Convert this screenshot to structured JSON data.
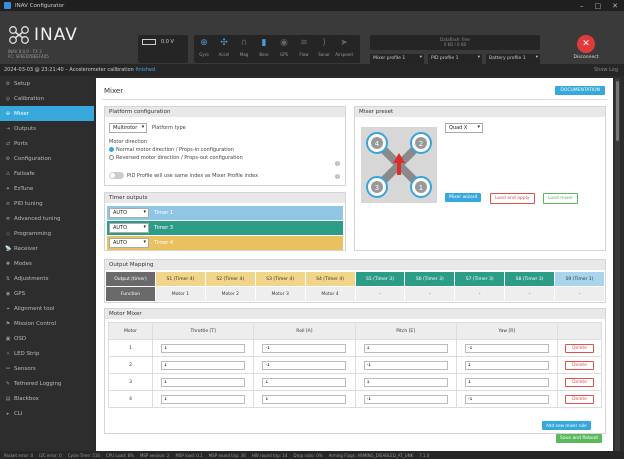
{
  "window": {
    "title": "INAV Configurator",
    "minimize": "–",
    "maximize": "□",
    "close": "✕"
  },
  "header": {
    "logo_text": "INAV",
    "version_line1": "INAV 8.0.0 · TX 3",
    "version_line2": "FC: SPEEDYBEEF405",
    "battery_voltage": "0.0 V",
    "sensors": [
      {
        "icon": "gyro-icon",
        "label": "Gyro",
        "active": true
      },
      {
        "icon": "accel-icon",
        "label": "Accel",
        "active": true
      },
      {
        "icon": "mag-icon",
        "label": "Mag",
        "active": false
      },
      {
        "icon": "baro-icon",
        "label": "Baro",
        "active": true
      },
      {
        "icon": "gps-icon",
        "label": "GPS",
        "active": false
      },
      {
        "icon": "flow-icon",
        "label": "Flow",
        "active": false
      },
      {
        "icon": "sonar-icon",
        "label": "Sonar",
        "active": false
      },
      {
        "icon": "airspeed-icon",
        "label": "Airspeed",
        "active": false
      }
    ],
    "dataflash_line1": "Dataflash: free",
    "dataflash_line2": "0 KB / 0 KB",
    "mixer_profile": "Mixer profile 1",
    "pid_profile": "PID profile 1",
    "battery_profile": "Battery profile 1",
    "disconnect_label": "Disconnect"
  },
  "status": {
    "text": "2024-03-03 @ 23:21:40 – Accelerometer calibration ",
    "link": "finished",
    "right": "Show Log"
  },
  "sidebar": {
    "items": [
      {
        "label": "Setup",
        "icon": "setup-icon",
        "active": false
      },
      {
        "label": "Calibration",
        "icon": "calibration-icon",
        "active": false
      },
      {
        "label": "Mixer",
        "icon": "mixer-icon",
        "active": true
      },
      {
        "label": "Outputs",
        "icon": "outputs-icon",
        "active": false
      },
      {
        "label": "Ports",
        "icon": "ports-icon",
        "active": false
      },
      {
        "label": "Configuration",
        "icon": "configuration-icon",
        "active": false
      },
      {
        "label": "Failsafe",
        "icon": "failsafe-icon",
        "active": false
      },
      {
        "label": "EzTune",
        "icon": "eztune-icon",
        "active": false
      },
      {
        "label": "PID tuning",
        "icon": "pid-icon",
        "active": false
      },
      {
        "label": "Advanced tuning",
        "icon": "advanced-icon",
        "active": false
      },
      {
        "label": "Programming",
        "icon": "programming-icon",
        "active": false
      },
      {
        "label": "Receiver",
        "icon": "receiver-icon",
        "active": false
      },
      {
        "label": "Modes",
        "icon": "modes-icon",
        "active": false
      },
      {
        "label": "Adjustments",
        "icon": "adjustments-icon",
        "active": false
      },
      {
        "label": "GPS",
        "icon": "gps-icon",
        "active": false
      },
      {
        "label": "Alignment tool",
        "icon": "alignment-icon",
        "active": false
      },
      {
        "label": "Mission Control",
        "icon": "mission-icon",
        "active": false
      },
      {
        "label": "OSD",
        "icon": "osd-icon",
        "active": false
      },
      {
        "label": "LED Strip",
        "icon": "led-icon",
        "active": false
      },
      {
        "label": "Sensors",
        "icon": "sensors-icon",
        "active": false
      },
      {
        "label": "Tethered Logging",
        "icon": "logging-icon",
        "active": false
      },
      {
        "label": "Blackbox",
        "icon": "blackbox-icon",
        "active": false
      },
      {
        "label": "CLI",
        "icon": "cli-icon",
        "active": false
      }
    ]
  },
  "page": {
    "title": "Mixer",
    "doc_button": "DOCUMENTATION"
  },
  "platform": {
    "heading": "Platform configuration",
    "type_value": "Multirotor",
    "type_label": "Platform type",
    "direction_heading": "Motor direction",
    "direction_normal": "Normal motor direction / Props-in configuration",
    "direction_reversed": "Reversed motor direction / Props-out configuration",
    "pid_toggle_label": "PID Profile will use same index as Mixer Profile index"
  },
  "timers": {
    "heading": "Timer outputs",
    "rows": [
      {
        "value": "AUTO",
        "label": "Timer 1",
        "color": "#8fc6e6"
      },
      {
        "value": "AUTO",
        "label": "Timer 3",
        "color": "#2b9d86"
      },
      {
        "value": "AUTO",
        "label": "Timer 4",
        "color": "#e9c15e"
      }
    ]
  },
  "preset": {
    "heading": "Mixer preset",
    "value": "Quad X",
    "motors": [
      "4",
      "2",
      "3",
      "1"
    ],
    "wizard_button": "Mixer wizard",
    "load_apply_button": "Load and apply",
    "load_button": "Load mixer"
  },
  "mapping": {
    "heading": "Output Mapping",
    "row_output_label": "Output (timer)",
    "row_function_label": "Function",
    "outputs": [
      {
        "name": "S1 (Timer 4)",
        "function": "Motor 1",
        "color": "#f0d58a"
      },
      {
        "name": "S2 (Timer 4)",
        "function": "Motor 2",
        "color": "#f0d58a"
      },
      {
        "name": "S3 (Timer 4)",
        "function": "Motor 3",
        "color": "#f0d58a"
      },
      {
        "name": "S4 (Timer 4)",
        "function": "Motor 4",
        "color": "#f0d58a"
      },
      {
        "name": "S5 (Timer 3)",
        "function": "-",
        "color": "#2b9d86"
      },
      {
        "name": "S6 (Timer 3)",
        "function": "-",
        "color": "#2b9d86"
      },
      {
        "name": "S7 (Timer 3)",
        "function": "-",
        "color": "#2b9d86"
      },
      {
        "name": "S8 (Timer 3)",
        "function": "-",
        "color": "#2b9d86"
      },
      {
        "name": "S9 (Timer 1)",
        "function": "-",
        "color": "#a9d4ee"
      }
    ]
  },
  "motor_mixer": {
    "heading": "Motor Mixer",
    "columns": [
      "Motor",
      "Throttle [T]",
      "Roll [A]",
      "Pitch [E]",
      "Yaw [R]",
      ""
    ],
    "rows": [
      {
        "motor": "1",
        "throttle": "1",
        "roll": "-1",
        "pitch": "1",
        "yaw": "-1"
      },
      {
        "motor": "2",
        "throttle": "1",
        "roll": "-1",
        "pitch": "-1",
        "yaw": "1"
      },
      {
        "motor": "3",
        "throttle": "1",
        "roll": "1",
        "pitch": "1",
        "yaw": "1"
      },
      {
        "motor": "4",
        "throttle": "1",
        "roll": "1",
        "pitch": "-1",
        "yaw": "-1"
      }
    ],
    "delete_label": "Delete",
    "add_button": "Add new mixer rule",
    "save_button": "Save and Reboot"
  },
  "footer": {
    "items": [
      "Packet error: 0",
      "I2C error: 0",
      "Cycle Time: 516",
      "CPU Load: 8%",
      "MSP version: 2",
      "MSP load: 0.1",
      "MSP round trip: 36",
      "HW round trip: 14",
      "Drop ratio: 0%",
      "Arming Flags: ARMING_DISABLED_AT_UNK",
      "7.1.0"
    ]
  },
  "colors": {
    "accent": "#37a8db",
    "danger": "#d9534f",
    "success": "#5cb85c"
  }
}
